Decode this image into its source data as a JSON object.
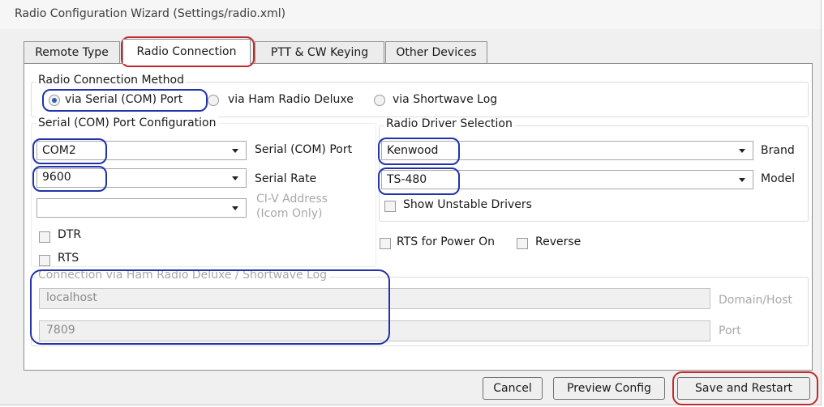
{
  "window": {
    "title": "Radio Configuration Wizard (Settings/radio.xml)"
  },
  "tabs": [
    {
      "label": "Remote Type"
    },
    {
      "label": "Radio Connection"
    },
    {
      "label": "PTT & CW Keying"
    },
    {
      "label": "Other Devices"
    }
  ],
  "connection_method": {
    "label": "Radio Connection Method",
    "options": [
      {
        "label": "via Serial (COM) Port",
        "selected": true
      },
      {
        "label": "via Ham Radio Deluxe",
        "selected": false
      },
      {
        "label": "via Shortwave Log",
        "selected": false
      }
    ]
  },
  "serial": {
    "label": "Serial (COM) Port Configuration",
    "port_value": "COM2",
    "port_label": "Serial (COM) Port",
    "rate_value": "9600",
    "rate_label": "Serial Rate",
    "civ_value": "",
    "civ_label_line1": "CI-V Address",
    "civ_label_line2": "(Icom Only)",
    "dtr_label": "DTR",
    "rts_label": "RTS"
  },
  "driver": {
    "label": "Radio Driver Selection",
    "brand_value": "Kenwood",
    "brand_label": "Brand",
    "model_value": "TS-480",
    "model_label": "Model",
    "unstable_label": "Show Unstable Drivers",
    "rts_power_label": "RTS for Power On",
    "reverse_label": "Reverse"
  },
  "hrd": {
    "label": "Connection via Ham Radio Deluxe / Shortwave Log",
    "host_value": "localhost",
    "host_label": "Domain/Host",
    "port_value": "7809",
    "port_label": "Port"
  },
  "buttons": {
    "cancel": "Cancel",
    "preview": "Preview Config",
    "save": "Save and Restart"
  },
  "colors": {
    "highlight_blue": "#2233aa",
    "highlight_red": "#c02a2a"
  }
}
